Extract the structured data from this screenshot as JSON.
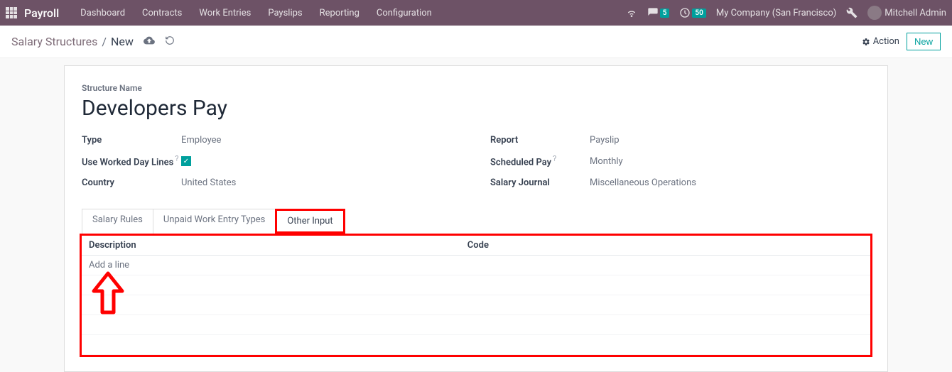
{
  "navbar": {
    "brand": "Payroll",
    "links": [
      "Dashboard",
      "Contracts",
      "Work Entries",
      "Payslips",
      "Reporting",
      "Configuration"
    ],
    "msg_count": "5",
    "timer_count": "50",
    "company": "My Company (San Francisco)",
    "user": "Mitchell Admin"
  },
  "breadcrumb": {
    "parent": "Salary Structures",
    "current": "New",
    "action": "Action",
    "new": "New"
  },
  "form": {
    "name_label": "Structure Name",
    "name": "Developers Pay",
    "left": {
      "type_label": "Type",
      "type": "Employee",
      "wdl_label": "Use Worked Day Lines",
      "country_label": "Country",
      "country": "United States"
    },
    "right": {
      "report_label": "Report",
      "report": "Payslip",
      "sched_label": "Scheduled Pay",
      "sched": "Monthly",
      "journal_label": "Salary Journal",
      "journal": "Miscellaneous Operations"
    }
  },
  "tabs": {
    "t0": "Salary Rules",
    "t1": "Unpaid Work Entry Types",
    "t2": "Other Input"
  },
  "table": {
    "col_desc": "Description",
    "col_code": "Code",
    "add": "Add a line"
  }
}
